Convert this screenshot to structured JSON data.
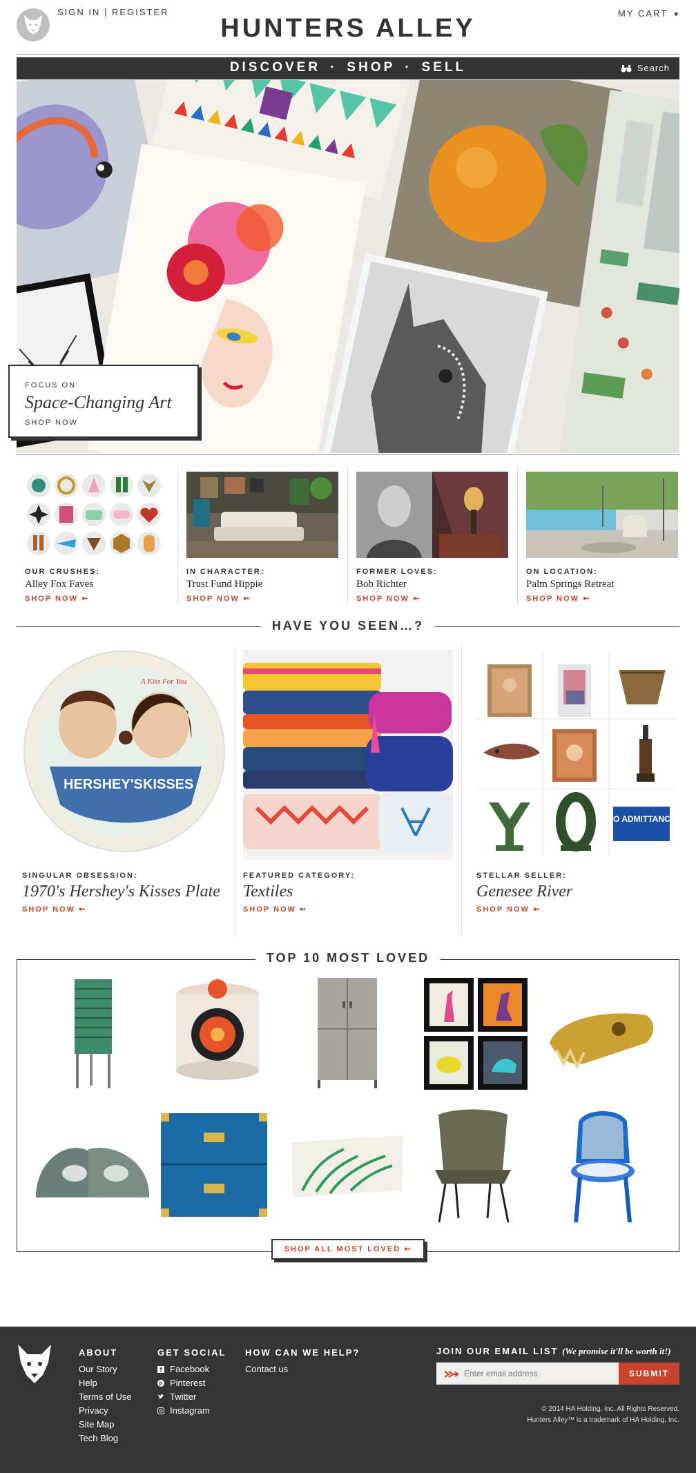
{
  "header": {
    "sign_in": "SIGN IN",
    "divider": "|",
    "register": "REGISTER",
    "brand": "HUNTERS ALLEY",
    "cart": "MY CART",
    "cart_caret": "▾"
  },
  "nav": {
    "items": [
      "DISCOVER",
      "SHOP",
      "SELL"
    ],
    "dot": "·",
    "search": "Search"
  },
  "hero": {
    "kicker": "FOCUS ON:",
    "title": "Space-Changing Art",
    "cta": "SHOP NOW"
  },
  "features": [
    {
      "kicker": "OUR CRUSHES:",
      "title": "Alley Fox Faves",
      "cta": "SHOP NOW ➳"
    },
    {
      "kicker": "IN CHARACTER:",
      "title": "Trust Fund Hippie",
      "cta": "SHOP NOW ➳"
    },
    {
      "kicker": "FORMER LOVES:",
      "title": "Bob Richter",
      "cta": "SHOP NOW ➳"
    },
    {
      "kicker": "ON LOCATION:",
      "title": "Palm Springs Retreat",
      "cta": "SHOP NOW ➳"
    }
  ],
  "have_you_seen": {
    "heading": "HAVE YOU SEEN…?",
    "columns": [
      {
        "kicker": "SINGULAR OBSESSION:",
        "title": "1970's Hershey's Kisses Plate",
        "cta": "SHOP NOW ➳"
      },
      {
        "kicker": "FEATURED CATEGORY:",
        "title": "Textiles",
        "cta": "SHOP NOW ➳"
      },
      {
        "kicker": "STELLAR SELLER:",
        "title": "Genesee River",
        "cta": "SHOP NOW ➳"
      }
    ],
    "plate_text": {
      "top": "A Kiss For You",
      "left": "HERSHEY'S",
      "right": "KISSES"
    },
    "seller_sign": "NO ADMITTANCE"
  },
  "top10": {
    "heading": "TOP 10 MOST LOVED",
    "cta": "SHOP ALL MOST LOVED ➳"
  },
  "footer": {
    "about": {
      "heading": "ABOUT",
      "links": [
        "Our Story",
        "Help",
        "Terms of Use",
        "Privacy",
        "Site Map",
        "Tech Blog"
      ]
    },
    "social": {
      "heading": "GET SOCIAL",
      "links": [
        "Facebook",
        "Pinterest",
        "Twitter",
        "Instagram"
      ]
    },
    "help": {
      "heading": "HOW CAN WE HELP?",
      "links": [
        "Contact us"
      ]
    },
    "email": {
      "heading": "JOIN OUR EMAIL LIST",
      "note": "(We promise it'll be worth it!)",
      "placeholder": "Enter email address",
      "submit": "SUBMIT"
    },
    "copyright": "© 2014 HA Holding, Inc. All Rights Reserved.",
    "trademark": "Hunters Alley™ is a trademark of HA Holding, Inc."
  },
  "colors": {
    "accent": "#c8432b",
    "dark": "#333333",
    "footer": "#343434"
  }
}
